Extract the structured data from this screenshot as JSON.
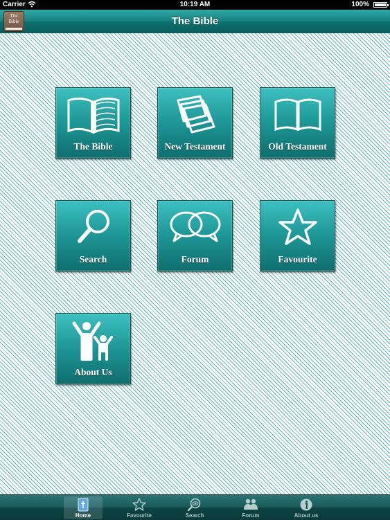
{
  "status_bar": {
    "carrier": "Carrier",
    "time": "10:19 AM",
    "battery": "100%"
  },
  "header": {
    "title": "The Bible",
    "badge_text": "The\nBible"
  },
  "tiles": [
    {
      "label": "The Bible",
      "icon": "open-book-icon"
    },
    {
      "label": "New Testament",
      "icon": "stacked-pages-icon"
    },
    {
      "label": "Old Testament",
      "icon": "open-book-icon"
    },
    {
      "label": "Search",
      "icon": "search-icon"
    },
    {
      "label": "Forum",
      "icon": "chat-bubbles-icon"
    },
    {
      "label": "Favourite",
      "icon": "star-icon"
    },
    {
      "label": "About Us",
      "icon": "people-icon"
    }
  ],
  "tab_bar": {
    "items": [
      {
        "label": "Home",
        "icon": "book-home-icon",
        "selected": true
      },
      {
        "label": "Favourite",
        "icon": "star-icon",
        "selected": false
      },
      {
        "label": "Search",
        "icon": "search-eye-icon",
        "selected": false
      },
      {
        "label": "Forum",
        "icon": "people-icon",
        "selected": false
      },
      {
        "label": "About us",
        "icon": "info-icon",
        "selected": false
      }
    ]
  },
  "colors": {
    "accent": "#1f9a9a",
    "nav_bar": "#16807f",
    "tab_bar": "#0d4343",
    "stripe": "#5fb6b6"
  }
}
